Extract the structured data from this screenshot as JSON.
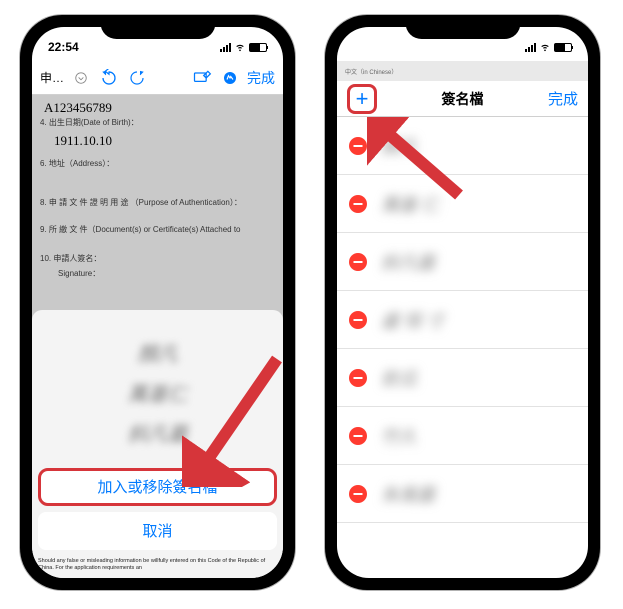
{
  "left": {
    "status_time": "22:54",
    "back_label": "申…",
    "done": "完成",
    "id_value": "A123456789",
    "dob_label": "4. 出生日期(Date of Birth)：",
    "dob_value": "1911.10.10",
    "addr_label": "6.  地址（Address）：",
    "purpose_label": "8. 申 請 文 件 證 明 用 途 （Purpose of Authentication）：",
    "docs_label": "9. 所 繳 文 件（Document(s) or Certificate(s) Attached to",
    "sig_label": "10. 申請人簽名：",
    "sig_sub": "Signature：",
    "sheet_add": "加入或移除簽名檔",
    "sheet_cancel": "取消",
    "fineprint": "Should any false or misleading information be willfully entered on this Code of the Republic of China.    For the application requirements an"
  },
  "right": {
    "topstrip": "中文（in Chinese）",
    "title": "簽名檔",
    "done": "完成"
  }
}
